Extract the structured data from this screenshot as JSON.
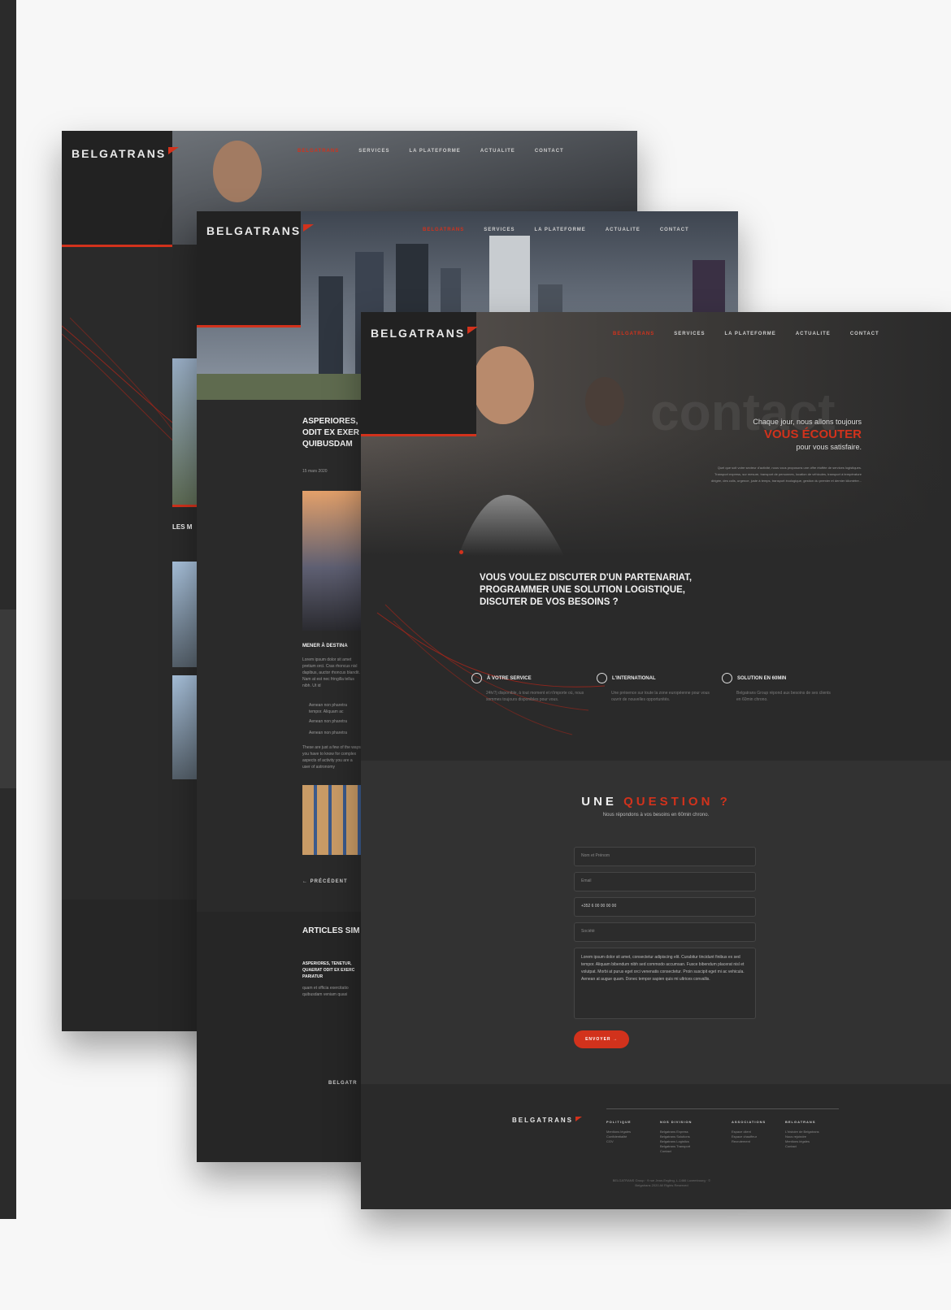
{
  "brand": {
    "name": "BELGATRANS",
    "accent": "#d2321c",
    "dark": "#2a2a2a"
  },
  "nav": [
    "BELGATRANS",
    "SERVICES",
    "LA PLATEFORME",
    "ACTUALITE",
    "CONTACT"
  ],
  "article_page": {
    "partial_heading": "LES M",
    "article_title": "ASPERIORES, ODIT EX EXER QUIBUSDAM",
    "date": "15 mars 2020",
    "section_heading": "MENER À DESTINA",
    "body": "Lorem ipsum dolor sit amet pretium orci. Cras rhoncus nisl dapibus, auctor rhoncus blandit. Nam at est nec fringilla tellus nibh. Ut id",
    "bullets": [
      "Aenean non pharetra tempor. Aliquam ac",
      "Aenean non pharetra",
      "Aenean non pharetra"
    ],
    "body2": "These are just a few of the ways you have to know for complex aspects of activity you are a user of astronomy",
    "prev_link": "PRÉCÉDENT",
    "similar_heading": "ARTICLES SIM",
    "similar_title": "ASPERIORES, TENETUR, QUAERAT ODIT EX EXERC PARIATUR",
    "similar_text": "quam et officia exercitatio quibusdam veniam quasi",
    "footer_logo": "BELGATR"
  },
  "contact_page": {
    "watermark": "contact",
    "tagline_1": "Chaque jour, nous allons toujours",
    "tagline_2": "VOUS ÉCOUTER",
    "tagline_3": "pour vous satisfaire.",
    "intro": "Quel que soit votre secteur d'activité, nous vous proposons une offre étoffée de services logistiques. Transport express, sur mesure, transport de personnes, location de véhicules, transport à température dirigée, des colis, urgence, juste à temps, transport écologique, gestion du premier et dernier kilomètre...",
    "cta": "VOUS VOULEZ DISCUTER D'UN PARTENARIAT, PROGRAMMER UNE SOLUTION LOGISTIQUE, DISCUTER DE VOS BESOINS ?",
    "features": [
      {
        "title": "À VOTRE SERVICE",
        "text": "24h/7j disponible, à tout moment et n'importe où, nous sommes toujours disponibles pour vous.",
        "icon": "stopwatch-icon"
      },
      {
        "title": "L'INTERNATIONAL",
        "text": "Une présence sur toute la zone européenne pour vous ouvrir de nouvelles opportunités.",
        "icon": "stopwatch-icon"
      },
      {
        "title": "SOLUTION EN 60MIN",
        "text": "Belgatrans Group répond aux besoins de ses clients en 60min chrono.",
        "icon": "stopwatch-icon"
      }
    ],
    "form": {
      "title_1": "UNE",
      "title_2": "QUESTION ?",
      "subtitle": "Nous répondons à vos besoins en 60min chrono.",
      "name_placeholder": "Nom et Prénom",
      "email_placeholder": "Email",
      "phone_value": "+352 6 00 00 00 00",
      "company_placeholder": "Société",
      "message_value": "Lorem ipsum dolor sit amet, consectetur adipiscing elit. Curabitur tincidunt finibus ex sed tempor. Aliquam bibendum nibh sed commodo accumsan. Fusce bibendum placerat nisl et volutpat. Morbi at purus eget orci venenatis consectetur. Proin suscipit eget mi ac vehicula. Aenean at augue quam. Donec tempor sapien quis mi ultrices convallis.",
      "submit": "ENVOYER"
    },
    "footer": {
      "logo": "BELGATRANS",
      "columns": [
        {
          "heading": "POLITIQUE",
          "items": [
            "Mentions légales",
            "Confidentialité",
            "CGV"
          ]
        },
        {
          "heading": "NOS DIVISION",
          "items": [
            "Belgatrans Express",
            "Belgatrans Solutions",
            "Belgatrans Logistics",
            "Belgatrans Transport",
            "Contact"
          ]
        },
        {
          "heading": "ASSOCIATIONS",
          "items": [
            "Espace client",
            "Espace chauffeur",
            "Recrutement"
          ]
        },
        {
          "heading": "BELGATRANS",
          "items": [
            "L'histoire de Belgatrans",
            "Nous rejoindre",
            "Mentions légales",
            "Contact"
          ]
        }
      ],
      "copyright": "BELGATRANS Group · 9 rue Jean-Engling, L-1466 Luxembourg · © Belgatrans 2020 All Rights Reserved"
    }
  }
}
